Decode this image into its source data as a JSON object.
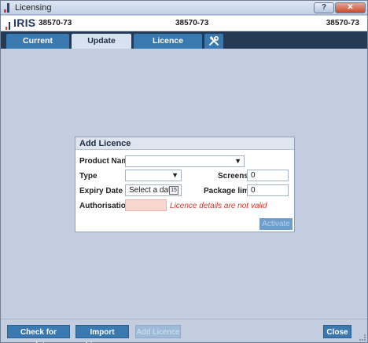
{
  "window": {
    "title": "Licensing",
    "help_label": "?",
    "close_label": "✕"
  },
  "header": {
    "logo": "IRIS",
    "code_left": "38570-73",
    "code_mid": "38570-73",
    "code_right": "38570-73"
  },
  "tabs": [
    {
      "label": "Current Licences",
      "active": false
    },
    {
      "label": "Update Licences",
      "active": true
    },
    {
      "label": "Licence Agreement",
      "active": false
    },
    {
      "label": "",
      "icon": "tools-icon"
    }
  ],
  "add_licence": {
    "title": "Add Licence",
    "product_name_label": "Product Name",
    "product_name_value": "",
    "type_label": "Type",
    "type_value": "",
    "screens_label": "Screens",
    "screens_value": "0",
    "expiry_label": "Expiry Date",
    "expiry_placeholder": "Select a date",
    "calendar_day": "15",
    "package_limit_label": "Package limit",
    "package_limit_value": "0",
    "authorisation_label": "Authorisation",
    "authorisation_value": "",
    "error_message": "Licence details are not valid",
    "activate_label": "Activate"
  },
  "footer": {
    "check_updates": "Check for updates",
    "import_licences": "Import Licences",
    "add_licence": "Add Licence",
    "close": "Close"
  },
  "colors": {
    "tab_bar": "#243a55",
    "tab": "#3a78b0",
    "active_tab": "#d6e2ef",
    "error": "#d2352a",
    "invalid_field": "#f9d6d0"
  }
}
